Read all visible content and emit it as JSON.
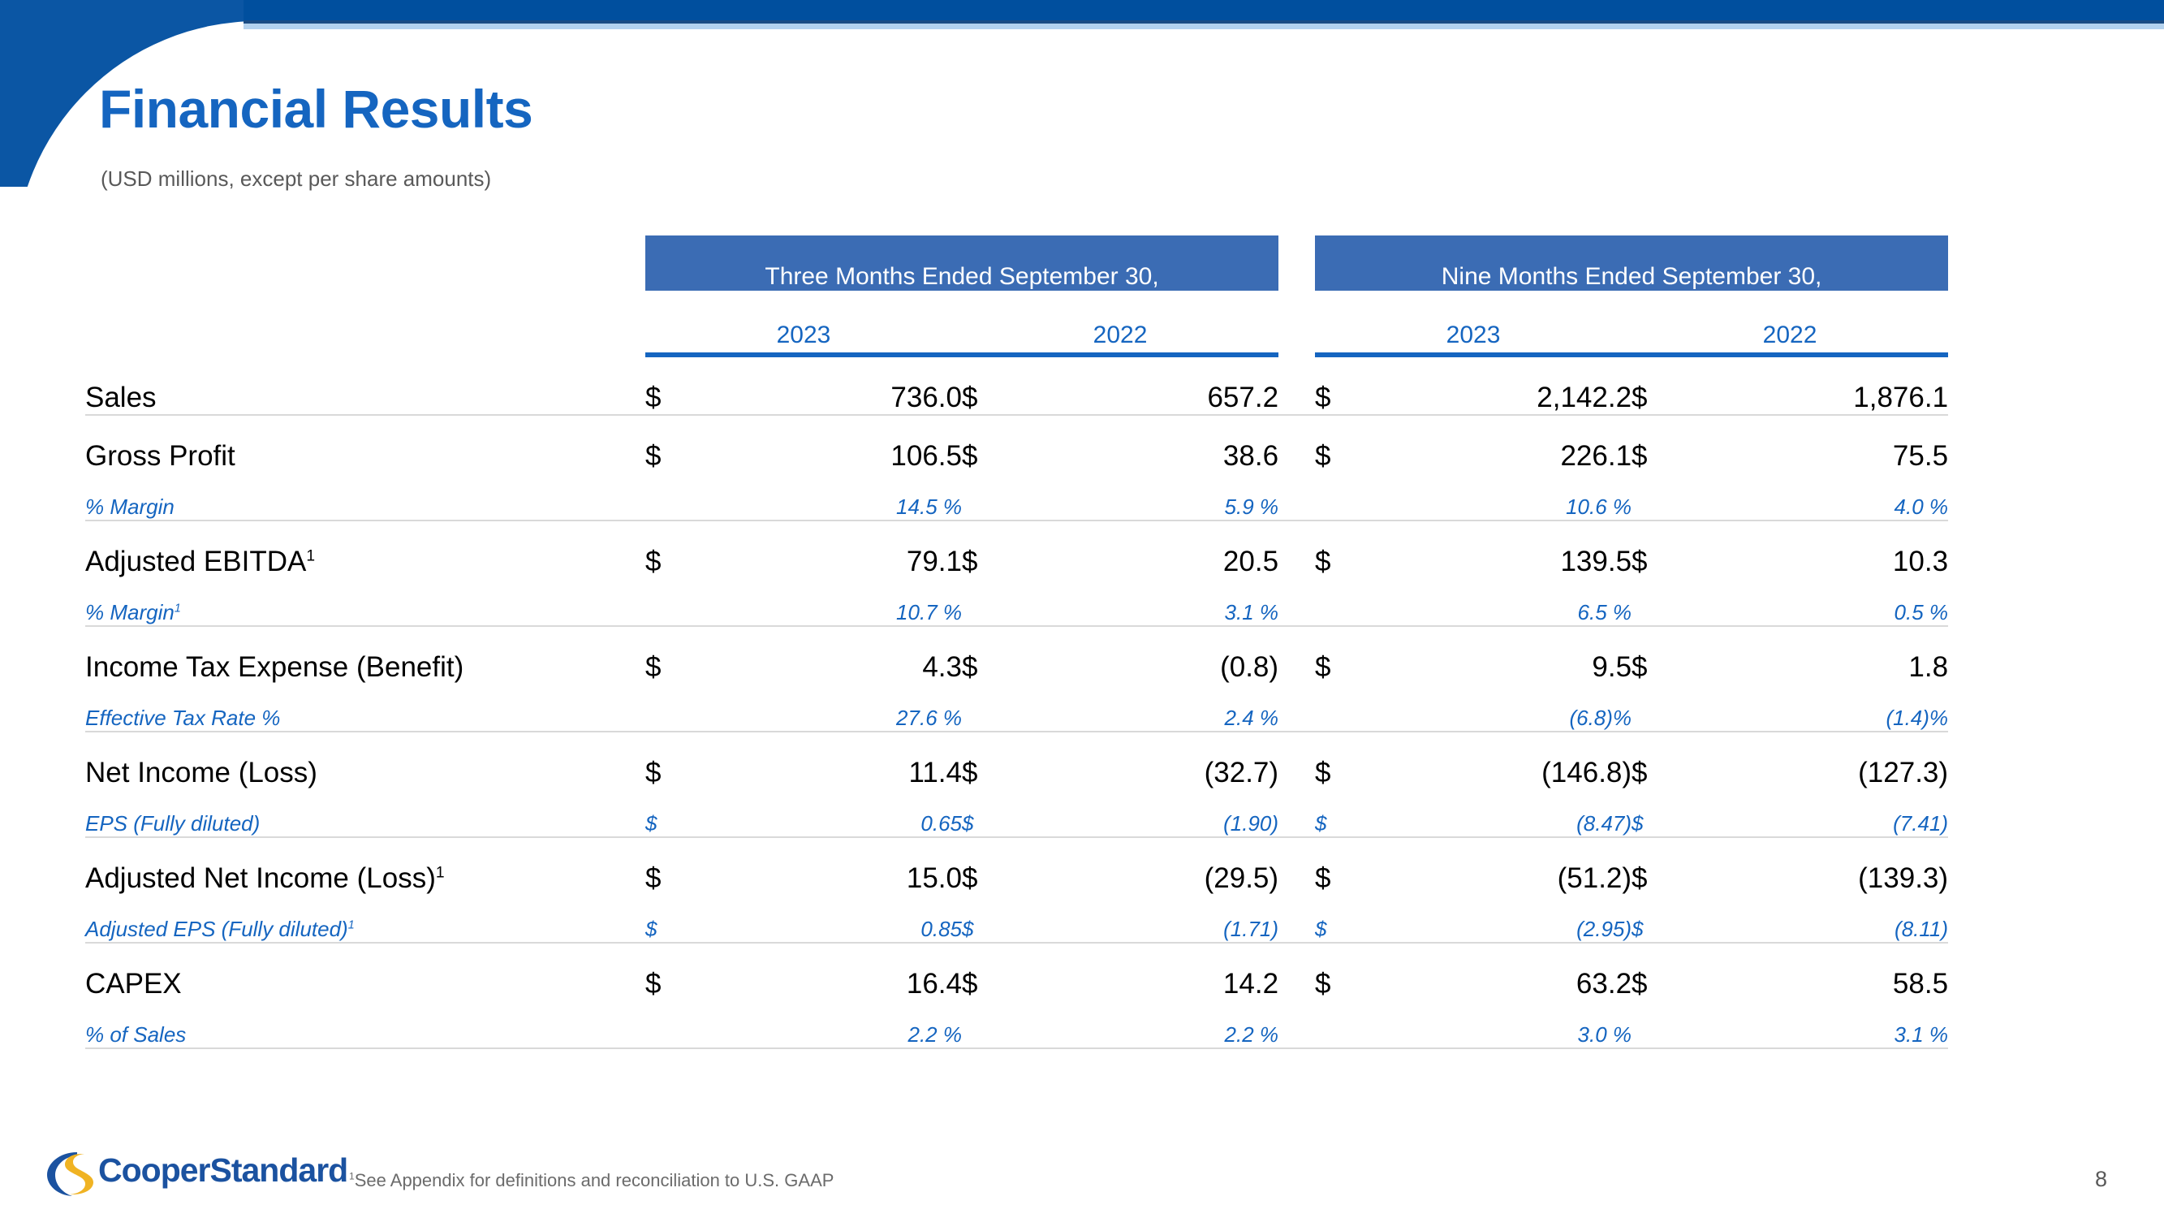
{
  "slide": {
    "title": "Financial Results",
    "subtitle": "(USD millions, except per share amounts)",
    "page_number": "8",
    "accent_blue": "#1565C0",
    "header_band_blue": "#3B6CB4",
    "top_bar_blue": "#004F9E"
  },
  "logo": {
    "wordmark": "CooperStandard",
    "mark_blue": "#1B52A0",
    "mark_gold": "#F0B323"
  },
  "footnote": {
    "marker": "1",
    "text": "See Appendix for definitions and reconciliation to U.S. GAAP"
  },
  "table": {
    "groups": [
      {
        "label": "Three Months Ended September 30,"
      },
      {
        "label": "Nine Months Ended September 30,"
      }
    ],
    "years": [
      "2023",
      "2022",
      "2023",
      "2022"
    ],
    "rows": [
      {
        "type": "main",
        "label": "Sales",
        "cells": [
          {
            "currency": "$",
            "value": "736.0"
          },
          {
            "currency": "$",
            "value": "657.2"
          },
          {
            "currency": "$",
            "value": "2,142.2"
          },
          {
            "currency": "$",
            "value": "1,876.1"
          }
        ]
      },
      {
        "type": "main",
        "label": "Gross Profit",
        "cells": [
          {
            "currency": "$",
            "value": "106.5"
          },
          {
            "currency": "$",
            "value": "38.6"
          },
          {
            "currency": "$",
            "value": "226.1"
          },
          {
            "currency": "$",
            "value": "75.5"
          }
        ]
      },
      {
        "type": "sub",
        "label": "% Margin",
        "cells": [
          {
            "currency": "",
            "value": "14.5 %"
          },
          {
            "currency": "",
            "value": "5.9 %"
          },
          {
            "currency": "",
            "value": "10.6 %"
          },
          {
            "currency": "",
            "value": "4.0 %"
          }
        ]
      },
      {
        "type": "main",
        "label": "Adjusted EBITDA",
        "sup": "1",
        "cells": [
          {
            "currency": "$",
            "value": "79.1"
          },
          {
            "currency": "$",
            "value": "20.5"
          },
          {
            "currency": "$",
            "value": "139.5"
          },
          {
            "currency": "$",
            "value": "10.3"
          }
        ]
      },
      {
        "type": "sub",
        "label": "% Margin",
        "sup": "1",
        "cells": [
          {
            "currency": "",
            "value": "10.7 %"
          },
          {
            "currency": "",
            "value": "3.1 %"
          },
          {
            "currency": "",
            "value": "6.5 %"
          },
          {
            "currency": "",
            "value": "0.5 %"
          }
        ]
      },
      {
        "type": "main",
        "label": "Income Tax Expense (Benefit)",
        "cells": [
          {
            "currency": "$",
            "value": "4.3"
          },
          {
            "currency": "$",
            "value": "(0.8)"
          },
          {
            "currency": "$",
            "value": "9.5"
          },
          {
            "currency": "$",
            "value": "1.8"
          }
        ]
      },
      {
        "type": "sub",
        "label": "Effective Tax Rate %",
        "cells": [
          {
            "currency": "",
            "value": "27.6 %"
          },
          {
            "currency": "",
            "value": "2.4 %"
          },
          {
            "currency": "",
            "value": "(6.8)%"
          },
          {
            "currency": "",
            "value": "(1.4)%"
          }
        ]
      },
      {
        "type": "main",
        "label": "Net Income (Loss)",
        "cells": [
          {
            "currency": "$",
            "value": "11.4"
          },
          {
            "currency": "$",
            "value": "(32.7)"
          },
          {
            "currency": "$",
            "value": "(146.8)"
          },
          {
            "currency": "$",
            "value": "(127.3)"
          }
        ]
      },
      {
        "type": "sub",
        "label": "EPS (Fully diluted)",
        "cells": [
          {
            "currency": "$",
            "value": "0.65"
          },
          {
            "currency": "$",
            "value": "(1.90)"
          },
          {
            "currency": "$",
            "value": "(8.47)"
          },
          {
            "currency": "$",
            "value": "(7.41)"
          }
        ]
      },
      {
        "type": "main",
        "label": "Adjusted Net Income (Loss)",
        "sup": "1",
        "cells": [
          {
            "currency": "$",
            "value": "15.0"
          },
          {
            "currency": "$",
            "value": "(29.5)"
          },
          {
            "currency": "$",
            "value": "(51.2)"
          },
          {
            "currency": "$",
            "value": "(139.3)"
          }
        ]
      },
      {
        "type": "sub",
        "label": "Adjusted EPS (Fully diluted)",
        "sup": "1",
        "cells": [
          {
            "currency": "$",
            "value": "0.85"
          },
          {
            "currency": "$",
            "value": "(1.71)"
          },
          {
            "currency": "$",
            "value": "(2.95)"
          },
          {
            "currency": "$",
            "value": "(8.11)"
          }
        ]
      },
      {
        "type": "main",
        "label": "CAPEX",
        "cells": [
          {
            "currency": "$",
            "value": "16.4"
          },
          {
            "currency": "$",
            "value": "14.2"
          },
          {
            "currency": "$",
            "value": "63.2"
          },
          {
            "currency": "$",
            "value": "58.5"
          }
        ]
      },
      {
        "type": "sub",
        "label": "% of Sales",
        "cells": [
          {
            "currency": "",
            "value": "2.2 %"
          },
          {
            "currency": "",
            "value": "2.2 %"
          },
          {
            "currency": "",
            "value": "3.0 %"
          },
          {
            "currency": "",
            "value": "3.1 %"
          }
        ]
      }
    ]
  }
}
